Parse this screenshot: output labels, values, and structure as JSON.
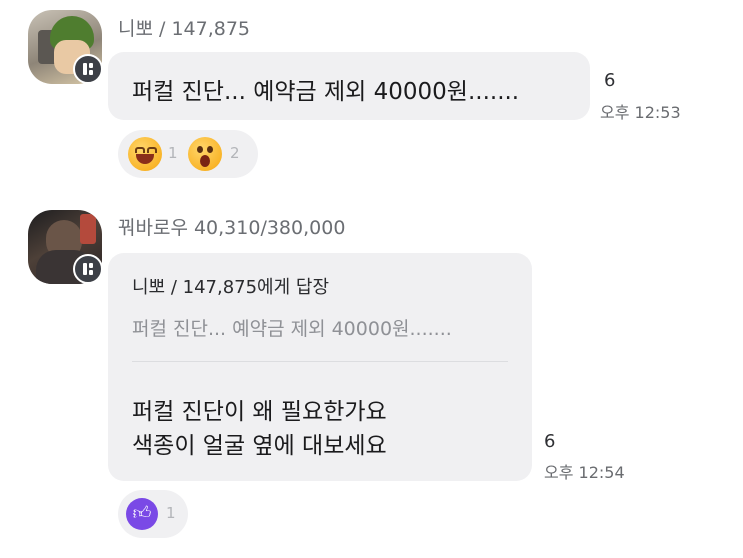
{
  "messages": [
    {
      "author": "니뽀 / 147,875",
      "text": "퍼컬 진단... 예약금 제외 40000원.......",
      "unread_count": "6",
      "time": "오후 12:53",
      "reactions": [
        {
          "icon": "laughing-emoji-icon",
          "count": "1"
        },
        {
          "icon": "surprised-emoji-icon",
          "count": "2"
        }
      ]
    },
    {
      "author": "꿔바로우 40,310/380,000",
      "reply_to": "니뽀 / 147,875에게 답장",
      "quoted_text": "퍼컬 진단... 예약금 제외 40000원.......",
      "lines": [
        "퍼컬 진단이 왜 필요한가요",
        "색종이 얼굴 옆에 대보세요"
      ],
      "unread_count": "6",
      "time": "오후 12:54",
      "reactions": [
        {
          "icon": "thumbs-up-icon",
          "count": "1"
        }
      ]
    }
  ],
  "colors": {
    "bubble": "#f0f0f2",
    "like_purple": "#7a49e6",
    "name_gray": "#6b6e73"
  }
}
